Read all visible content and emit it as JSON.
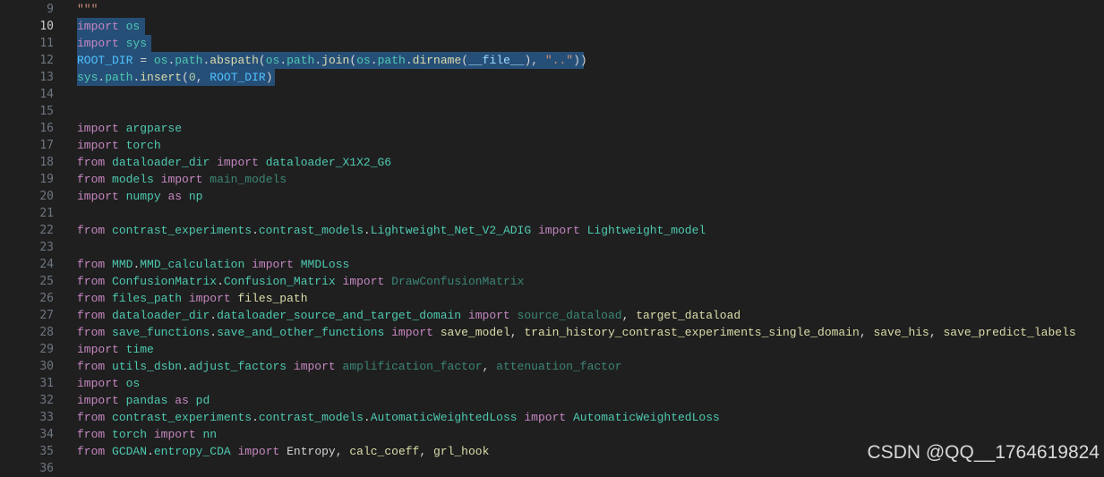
{
  "editor": {
    "active_line": "10",
    "lines": [
      {
        "no": "9",
        "tokens": [
          {
            "t": "\"\"\"",
            "c": "doc"
          }
        ]
      },
      {
        "no": "10",
        "sel": true,
        "tokens": [
          {
            "t": "import",
            "c": "kw"
          },
          {
            "t": " ",
            "c": "plain"
          },
          {
            "t": "os",
            "c": "mod"
          }
        ]
      },
      {
        "no": "11",
        "sel": true,
        "tokens": [
          {
            "t": "import",
            "c": "kw"
          },
          {
            "t": " ",
            "c": "plain"
          },
          {
            "t": "sys",
            "c": "mod"
          }
        ]
      },
      {
        "no": "12",
        "sel": true,
        "tokens": [
          {
            "t": "ROOT_DIR",
            "c": "const"
          },
          {
            "t": " = ",
            "c": "plain"
          },
          {
            "t": "os",
            "c": "mod"
          },
          {
            "t": ".",
            "c": "plain"
          },
          {
            "t": "path",
            "c": "mod"
          },
          {
            "t": ".",
            "c": "plain"
          },
          {
            "t": "abspath",
            "c": "fn"
          },
          {
            "t": "(",
            "c": "plain"
          },
          {
            "t": "os",
            "c": "mod"
          },
          {
            "t": ".",
            "c": "plain"
          },
          {
            "t": "path",
            "c": "mod"
          },
          {
            "t": ".",
            "c": "plain"
          },
          {
            "t": "join",
            "c": "fn"
          },
          {
            "t": "(",
            "c": "plain"
          },
          {
            "t": "os",
            "c": "mod"
          },
          {
            "t": ".",
            "c": "plain"
          },
          {
            "t": "path",
            "c": "mod"
          },
          {
            "t": ".",
            "c": "plain"
          },
          {
            "t": "dirname",
            "c": "fn"
          },
          {
            "t": "(",
            "c": "plain"
          },
          {
            "t": "__file__",
            "c": "var"
          },
          {
            "t": "), ",
            "c": "plain"
          },
          {
            "t": "\"..\"",
            "c": "str"
          },
          {
            "t": "))",
            "c": "plain"
          }
        ]
      },
      {
        "no": "13",
        "sel": true,
        "tokens": [
          {
            "t": "sys",
            "c": "mod"
          },
          {
            "t": ".",
            "c": "plain"
          },
          {
            "t": "path",
            "c": "mod"
          },
          {
            "t": ".",
            "c": "plain"
          },
          {
            "t": "insert",
            "c": "fn"
          },
          {
            "t": "(",
            "c": "plain"
          },
          {
            "t": "0",
            "c": "num"
          },
          {
            "t": ", ",
            "c": "plain"
          },
          {
            "t": "ROOT_DIR",
            "c": "const"
          },
          {
            "t": ")",
            "c": "plain"
          }
        ]
      },
      {
        "no": "14",
        "tokens": []
      },
      {
        "no": "15",
        "tokens": []
      },
      {
        "no": "16",
        "tokens": [
          {
            "t": "import",
            "c": "kw"
          },
          {
            "t": " ",
            "c": "plain"
          },
          {
            "t": "argparse",
            "c": "mod"
          }
        ]
      },
      {
        "no": "17",
        "tokens": [
          {
            "t": "import",
            "c": "kw"
          },
          {
            "t": " ",
            "c": "plain"
          },
          {
            "t": "torch",
            "c": "mod"
          }
        ]
      },
      {
        "no": "18",
        "tokens": [
          {
            "t": "from",
            "c": "kw"
          },
          {
            "t": " ",
            "c": "plain"
          },
          {
            "t": "dataloader_dir",
            "c": "mod"
          },
          {
            "t": " ",
            "c": "plain"
          },
          {
            "t": "import",
            "c": "kw"
          },
          {
            "t": " ",
            "c": "plain"
          },
          {
            "t": "dataloader_X1X2_G6",
            "c": "mod"
          }
        ]
      },
      {
        "no": "19",
        "tokens": [
          {
            "t": "from",
            "c": "kw"
          },
          {
            "t": " ",
            "c": "plain"
          },
          {
            "t": "models",
            "c": "mod"
          },
          {
            "t": " ",
            "c": "plain"
          },
          {
            "t": "import",
            "c": "kw"
          },
          {
            "t": " ",
            "c": "plain"
          },
          {
            "t": "main_models",
            "c": "dim"
          }
        ]
      },
      {
        "no": "20",
        "tokens": [
          {
            "t": "import",
            "c": "kw"
          },
          {
            "t": " ",
            "c": "plain"
          },
          {
            "t": "numpy",
            "c": "mod"
          },
          {
            "t": " ",
            "c": "plain"
          },
          {
            "t": "as",
            "c": "kw"
          },
          {
            "t": " ",
            "c": "plain"
          },
          {
            "t": "np",
            "c": "mod"
          }
        ]
      },
      {
        "no": "21",
        "tokens": []
      },
      {
        "no": "22",
        "tokens": [
          {
            "t": "from",
            "c": "kw"
          },
          {
            "t": " ",
            "c": "plain"
          },
          {
            "t": "contrast_experiments",
            "c": "mod"
          },
          {
            "t": ".",
            "c": "plain"
          },
          {
            "t": "contrast_models",
            "c": "mod"
          },
          {
            "t": ".",
            "c": "plain"
          },
          {
            "t": "Lightweight_Net_V2_ADIG",
            "c": "mod"
          },
          {
            "t": " ",
            "c": "plain"
          },
          {
            "t": "import",
            "c": "kw"
          },
          {
            "t": " ",
            "c": "plain"
          },
          {
            "t": "Lightweight_model",
            "c": "mod"
          }
        ]
      },
      {
        "no": "23",
        "tokens": []
      },
      {
        "no": "24",
        "tokens": [
          {
            "t": "from",
            "c": "kw"
          },
          {
            "t": " ",
            "c": "plain"
          },
          {
            "t": "MMD",
            "c": "mod"
          },
          {
            "t": ".",
            "c": "plain"
          },
          {
            "t": "MMD_calculation",
            "c": "mod"
          },
          {
            "t": " ",
            "c": "plain"
          },
          {
            "t": "import",
            "c": "kw"
          },
          {
            "t": " ",
            "c": "plain"
          },
          {
            "t": "MMDLoss",
            "c": "mod"
          }
        ]
      },
      {
        "no": "25",
        "tokens": [
          {
            "t": "from",
            "c": "kw"
          },
          {
            "t": " ",
            "c": "plain"
          },
          {
            "t": "ConfusionMatrix",
            "c": "mod"
          },
          {
            "t": ".",
            "c": "plain"
          },
          {
            "t": "Confusion_Matrix",
            "c": "mod"
          },
          {
            "t": " ",
            "c": "plain"
          },
          {
            "t": "import",
            "c": "kw"
          },
          {
            "t": " ",
            "c": "plain"
          },
          {
            "t": "DrawConfusionMatrix",
            "c": "dim"
          }
        ]
      },
      {
        "no": "26",
        "tokens": [
          {
            "t": "from",
            "c": "kw"
          },
          {
            "t": " ",
            "c": "plain"
          },
          {
            "t": "files_path",
            "c": "mod"
          },
          {
            "t": " ",
            "c": "plain"
          },
          {
            "t": "import",
            "c": "kw"
          },
          {
            "t": " ",
            "c": "plain"
          },
          {
            "t": "files_path",
            "c": "fn"
          }
        ]
      },
      {
        "no": "27",
        "tokens": [
          {
            "t": "from",
            "c": "kw"
          },
          {
            "t": " ",
            "c": "plain"
          },
          {
            "t": "dataloader_dir",
            "c": "mod"
          },
          {
            "t": ".",
            "c": "plain"
          },
          {
            "t": "dataloader_source_and_target_domain",
            "c": "mod"
          },
          {
            "t": " ",
            "c": "plain"
          },
          {
            "t": "import",
            "c": "kw"
          },
          {
            "t": " ",
            "c": "plain"
          },
          {
            "t": "source_dataload",
            "c": "dim"
          },
          {
            "t": ", ",
            "c": "plain"
          },
          {
            "t": "target_dataload",
            "c": "fn"
          }
        ]
      },
      {
        "no": "28",
        "tokens": [
          {
            "t": "from",
            "c": "kw"
          },
          {
            "t": " ",
            "c": "plain"
          },
          {
            "t": "save_functions",
            "c": "mod"
          },
          {
            "t": ".",
            "c": "plain"
          },
          {
            "t": "save_and_other_functions",
            "c": "mod"
          },
          {
            "t": " ",
            "c": "plain"
          },
          {
            "t": "import",
            "c": "kw"
          },
          {
            "t": " ",
            "c": "plain"
          },
          {
            "t": "save_model",
            "c": "fn"
          },
          {
            "t": ", ",
            "c": "plain"
          },
          {
            "t": "train_history_contrast_experiments_single_domain",
            "c": "fn"
          },
          {
            "t": ", ",
            "c": "plain"
          },
          {
            "t": "save_his",
            "c": "fn"
          },
          {
            "t": ", ",
            "c": "plain"
          },
          {
            "t": "save_predict_labels",
            "c": "fn"
          }
        ]
      },
      {
        "no": "29",
        "tokens": [
          {
            "t": "import",
            "c": "kw"
          },
          {
            "t": " ",
            "c": "plain"
          },
          {
            "t": "time",
            "c": "mod"
          }
        ]
      },
      {
        "no": "30",
        "tokens": [
          {
            "t": "from",
            "c": "kw"
          },
          {
            "t": " ",
            "c": "plain"
          },
          {
            "t": "utils_dsbn",
            "c": "mod"
          },
          {
            "t": ".",
            "c": "plain"
          },
          {
            "t": "adjust_factors",
            "c": "mod"
          },
          {
            "t": " ",
            "c": "plain"
          },
          {
            "t": "import",
            "c": "kw"
          },
          {
            "t": " ",
            "c": "plain"
          },
          {
            "t": "amplification_factor",
            "c": "dim"
          },
          {
            "t": ", ",
            "c": "plain"
          },
          {
            "t": "attenuation_factor",
            "c": "dim"
          }
        ]
      },
      {
        "no": "31",
        "tokens": [
          {
            "t": "import",
            "c": "kw"
          },
          {
            "t": " ",
            "c": "plain"
          },
          {
            "t": "os",
            "c": "mod"
          }
        ]
      },
      {
        "no": "32",
        "tokens": [
          {
            "t": "import",
            "c": "kw"
          },
          {
            "t": " ",
            "c": "plain"
          },
          {
            "t": "pandas",
            "c": "mod"
          },
          {
            "t": " ",
            "c": "plain"
          },
          {
            "t": "as",
            "c": "kw"
          },
          {
            "t": " ",
            "c": "plain"
          },
          {
            "t": "pd",
            "c": "mod"
          }
        ]
      },
      {
        "no": "33",
        "tokens": [
          {
            "t": "from",
            "c": "kw"
          },
          {
            "t": " ",
            "c": "plain"
          },
          {
            "t": "contrast_experiments",
            "c": "mod"
          },
          {
            "t": ".",
            "c": "plain"
          },
          {
            "t": "contrast_models",
            "c": "mod"
          },
          {
            "t": ".",
            "c": "plain"
          },
          {
            "t": "AutomaticWeightedLoss",
            "c": "mod"
          },
          {
            "t": " ",
            "c": "plain"
          },
          {
            "t": "import",
            "c": "kw"
          },
          {
            "t": " ",
            "c": "plain"
          },
          {
            "t": "AutomaticWeightedLoss",
            "c": "mod"
          }
        ]
      },
      {
        "no": "34",
        "tokens": [
          {
            "t": "from",
            "c": "kw"
          },
          {
            "t": " ",
            "c": "plain"
          },
          {
            "t": "torch",
            "c": "mod"
          },
          {
            "t": " ",
            "c": "plain"
          },
          {
            "t": "import",
            "c": "kw"
          },
          {
            "t": " ",
            "c": "plain"
          },
          {
            "t": "nn",
            "c": "mod"
          }
        ]
      },
      {
        "no": "35",
        "tokens": [
          {
            "t": "from",
            "c": "kw"
          },
          {
            "t": " ",
            "c": "plain"
          },
          {
            "t": "GCDAN",
            "c": "mod"
          },
          {
            "t": ".",
            "c": "plain"
          },
          {
            "t": "entropy_CDA",
            "c": "mod"
          },
          {
            "t": " ",
            "c": "plain"
          },
          {
            "t": "import",
            "c": "kw"
          },
          {
            "t": " ",
            "c": "plain"
          },
          {
            "t": "Entropy",
            "c": "plain"
          },
          {
            "t": ", ",
            "c": "plain"
          },
          {
            "t": "calc_coeff",
            "c": "fn"
          },
          {
            "t": ", ",
            "c": "plain"
          },
          {
            "t": "grl_hook",
            "c": "fn"
          }
        ]
      },
      {
        "no": "36",
        "tokens": []
      }
    ]
  },
  "watermark": "CSDN @QQ__1764619824"
}
